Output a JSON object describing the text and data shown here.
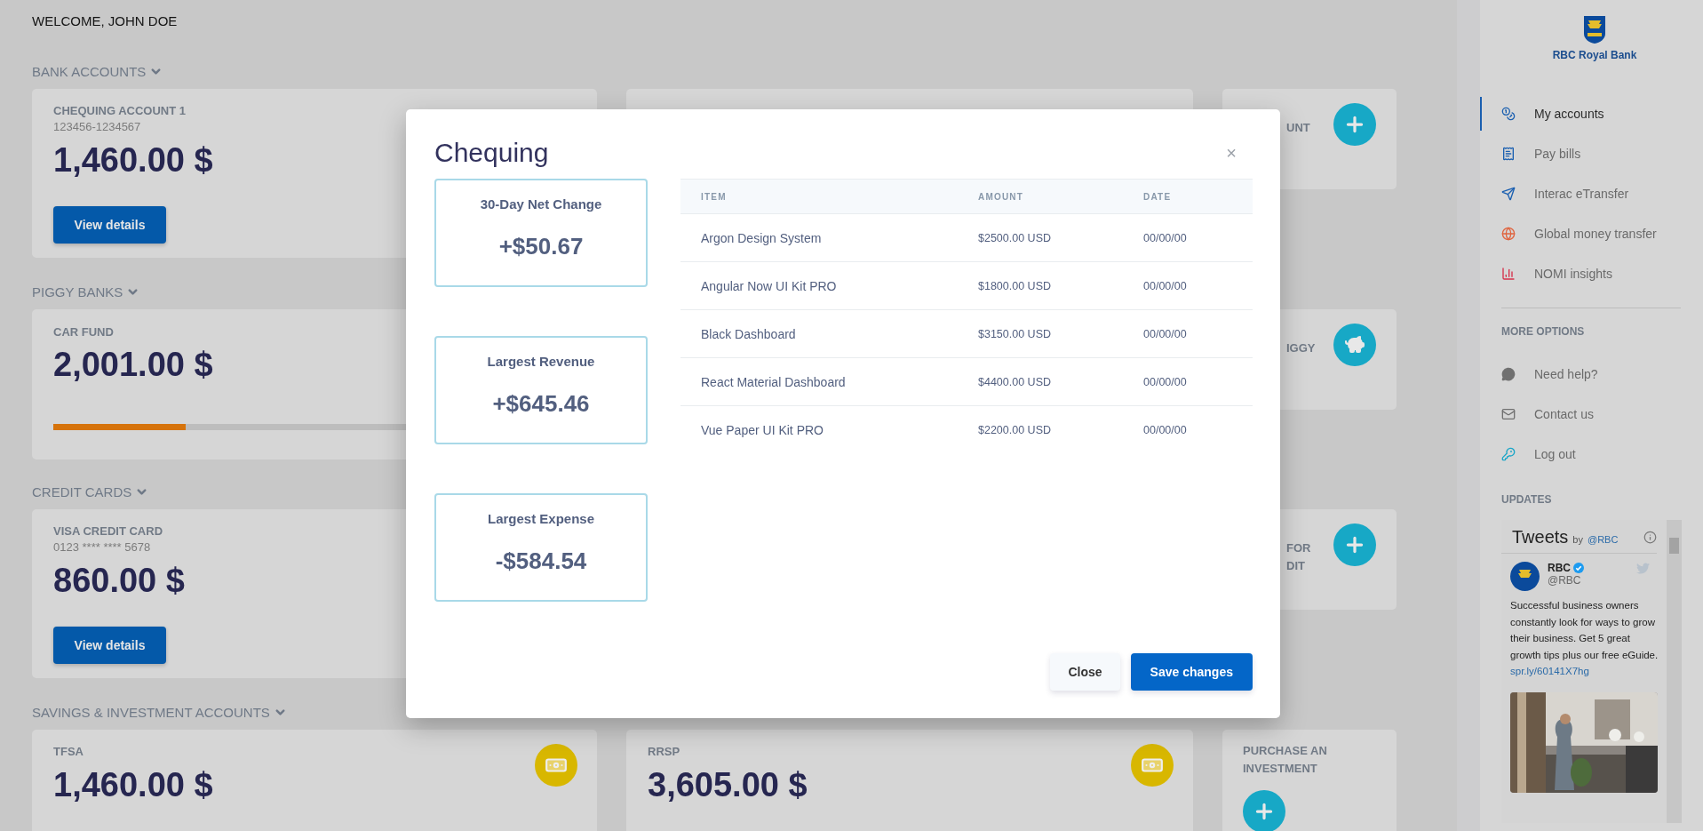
{
  "greeting": "WELCOME, JOHN DOE",
  "sections": [
    {
      "title": "BANK ACCOUNTS",
      "cards": [
        {
          "kind": "account",
          "name": "CHEQUING ACCOUNT 1",
          "number": "123456-1234567",
          "balance": "1,460.00 $",
          "button": "View details"
        },
        {
          "kind": "hidden"
        },
        {
          "kind": "add",
          "lines": [
            {
              "text": "UNT",
              "covered": true
            }
          ]
        }
      ]
    },
    {
      "title": "PIGGY BANKS",
      "cards": [
        {
          "kind": "goal",
          "name": "CAR FUND",
          "balance": "2,001.00 $",
          "level": 0.27
        },
        {
          "kind": "piggy",
          "lines": [
            {
              "text": "IGGY",
              "covered": true
            }
          ]
        }
      ]
    },
    {
      "title": "CREDIT CARDS",
      "cards": [
        {
          "kind": "account",
          "name": "VISA CREDIT CARD",
          "number": "0123 **** **** 5678",
          "balance": "860.00 $",
          "button": "View details"
        },
        {
          "kind": "add",
          "lines": [
            {
              "text": "FOR",
              "covered": true
            },
            {
              "text": "DIT",
              "covered": true
            }
          ]
        }
      ]
    },
    {
      "title": "SAVINGS & INVESTMENT ACCOUNTS",
      "cards": [
        {
          "kind": "savings",
          "name": "TFSA",
          "balance": "1,460.00 $"
        },
        {
          "kind": "savings",
          "name": "RRSP",
          "balance": "3,605.00 $"
        },
        {
          "kind": "invest",
          "lines": [
            {
              "text": "PURCHASE AN",
              "covered": false
            },
            {
              "text": "INVESTMENT",
              "covered": false
            }
          ]
        }
      ]
    }
  ],
  "sidebar": {
    "brand": "RBC Royal Bank",
    "nav": [
      {
        "label": "My accounts",
        "selected": true
      },
      {
        "label": "Pay bills",
        "selected": false
      },
      {
        "label": "Interac eTransfer",
        "selected": false
      },
      {
        "label": "Global money transfer",
        "selected": false
      },
      {
        "label": "NOMI insights",
        "selected": false
      }
    ],
    "more_title": "MORE OPTIONS",
    "options": [
      {
        "label": "Need help?"
      },
      {
        "label": "Contact us"
      },
      {
        "label": "Log out"
      }
    ],
    "updates_title": "UPDATES",
    "tweets": {
      "title": "Tweets",
      "by": "by",
      "handle_link": "@RBC",
      "author": "RBC",
      "author_handle": "@RBC",
      "text": "Successful business owners constantly look for ways to grow their business. Get 5 great growth tips plus our free eGuide.",
      "link": "spr.ly/60141X7hg"
    }
  },
  "modal": {
    "title": "Chequing",
    "close": "×",
    "stats": [
      {
        "label": "30-Day Net Change",
        "value": "+$50.67"
      },
      {
        "label": "Largest Revenue",
        "value": "+$645.46"
      },
      {
        "label": "Largest Expense",
        "value": "-$584.54"
      }
    ],
    "table": {
      "columns": [
        "ITEM",
        "AMOUNT",
        "DATE"
      ],
      "rows": [
        [
          "Argon Design System",
          "$2500.00 USD",
          "00/00/00"
        ],
        [
          "Angular Now UI Kit PRO",
          "$1800.00 USD",
          "00/00/00"
        ],
        [
          "Black Dashboard",
          "$3150.00 USD",
          "00/00/00"
        ],
        [
          "React Material Dashboard",
          "$4400.00 USD",
          "00/00/00"
        ],
        [
          "Vue Paper UI Kit PRO",
          "$2200.00 USD",
          "00/00/00"
        ]
      ]
    },
    "buttons": [
      {
        "label": "Close",
        "kind": "secondary"
      },
      {
        "label": "Save changes",
        "kind": "primary"
      }
    ]
  }
}
